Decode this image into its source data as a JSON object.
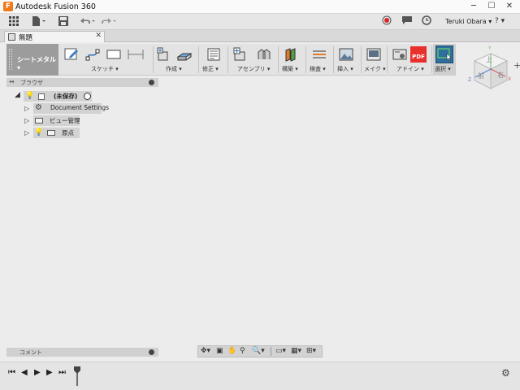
{
  "window": {
    "app_logo": "F",
    "title": "Autodesk Fusion 360",
    "minimize": "─",
    "maximize": "☐",
    "close": "✕"
  },
  "appbar": {
    "grid_icon": "grid-icon",
    "file_icon": "file-icon",
    "save_icon": "save-icon",
    "undo_icon": "undo-icon",
    "redo_icon": "redo-icon",
    "user_name": "Teruki Obara ▾",
    "help_label": "? ▾"
  },
  "document_tab": {
    "label": "無題",
    "close": "✕",
    "add": "+"
  },
  "toolbar": {
    "workspace_label": "シートメタル ▾",
    "groups": {
      "sketch": "スケッチ ▾",
      "create": "作成 ▾",
      "modify": "修正 ▾",
      "assemble": "アセンブリ ▾",
      "construct": "構築 ▾",
      "inspect": "検査 ▾",
      "insert": "挿入 ▾",
      "make": "メイク ▾",
      "addins": "アドイン ▾",
      "select": "選択 ▾"
    },
    "pdf_label": "PDF"
  },
  "viewcube": {
    "top": "上",
    "front": "前",
    "right": "右",
    "axis_y": "Y",
    "axis_x": "X",
    "axis_z": "Z"
  },
  "browser": {
    "title": "ブラウザ",
    "collapse": "◂◂",
    "root_label": "(未保存)",
    "items": [
      {
        "label": "Document Settings"
      },
      {
        "label": "ビュー管理"
      },
      {
        "label": "原点"
      }
    ]
  },
  "comments": {
    "title": "コメント"
  },
  "timeline": {
    "first": "⏮",
    "prev": "◀",
    "play": "▶",
    "next": "▶",
    "last": "⏭"
  },
  "colors": {
    "accent_orange": "#f07a1a",
    "select_blue": "#2e6f9e",
    "pdf_red": "#e8302c"
  }
}
